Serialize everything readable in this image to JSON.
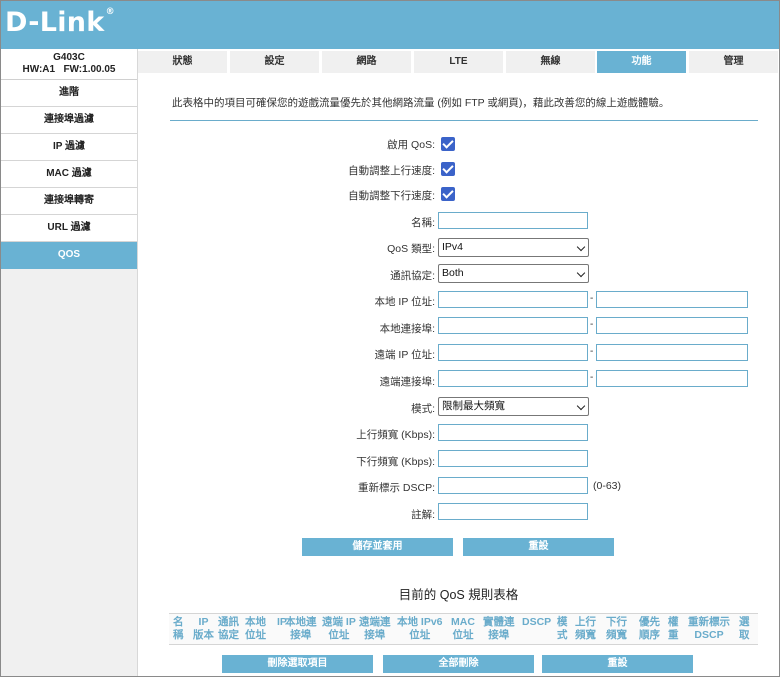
{
  "brand": {
    "logo": "D-Link",
    "reg_mark": "®"
  },
  "device": {
    "model": "G403C",
    "hw_label": "HW:A1",
    "fw_label": "FW:1.00.05"
  },
  "sidebar": {
    "items": [
      {
        "label": "進階",
        "active": false
      },
      {
        "label": "連接埠過濾",
        "active": false
      },
      {
        "label": "IP 過濾",
        "active": false
      },
      {
        "label": "MAC 過濾",
        "active": false
      },
      {
        "label": "連接埠轉寄",
        "active": false
      },
      {
        "label": "URL 過濾",
        "active": false
      },
      {
        "label": "QOS",
        "active": true
      }
    ]
  },
  "tabs": [
    {
      "label": "狀態",
      "active": false
    },
    {
      "label": "設定",
      "active": false
    },
    {
      "label": "網路",
      "active": false
    },
    {
      "label": "LTE",
      "active": false
    },
    {
      "label": "無線",
      "active": false
    },
    {
      "label": "功能",
      "active": true
    },
    {
      "label": "管理",
      "active": false
    }
  ],
  "intro": "此表格中的項目可確保您的遊戲流量優先於其他網路流量 (例如 FTP 或網頁)，藉此改善您的線上遊戲體驗。",
  "form": {
    "enable_qos_label": "啟用 QoS:",
    "enable_qos_checked": true,
    "auto_upload_label": "自動調整上行速度:",
    "auto_upload_checked": true,
    "auto_download_label": "自動調整下行速度:",
    "auto_download_checked": true,
    "name_label": "名稱:",
    "name_value": "",
    "qos_type_label": "QoS 類型:",
    "qos_type_value": "IPv4",
    "protocol_label": "通訊協定:",
    "protocol_value": "Both",
    "local_ip_label": "本地 IP 位址:",
    "local_port_label": "本地連接埠:",
    "remote_ip_label": "遠端 IP 位址:",
    "remote_port_label": "遠端連接埠:",
    "range_dash": "-",
    "mode_label": "模式:",
    "mode_value": "限制最大頻寬",
    "up_bw_label": "上行頻寬 (Kbps):",
    "down_bw_label": "下行頻寬 (Kbps):",
    "dscp_label": "重新標示 DSCP:",
    "dscp_hint": "(0-63)",
    "comment_label": "註解:",
    "save_button": "儲存並套用",
    "reset_button": "重設"
  },
  "rules_table": {
    "title": "目前的 QoS 規則表格",
    "columns": [
      [
        "名",
        "稱"
      ],
      [
        "IP",
        "版本"
      ],
      [
        "通訊",
        "協定"
      ],
      [
        "本地",
        "位址"
      ],
      [
        "IP",
        ""
      ],
      [
        "本地連",
        "接埠"
      ],
      [
        "遠端 IP",
        "位址"
      ],
      [
        "遠端連",
        "接埠"
      ],
      [
        "本地 IPv6",
        "位址"
      ],
      [
        "MAC",
        "位址"
      ],
      [
        "實體連",
        "接埠"
      ],
      [
        "DSCP",
        ""
      ],
      [
        "模",
        "式"
      ],
      [
        "上行",
        "頻寬"
      ],
      [
        "下行",
        "頻寬"
      ],
      [
        "優先",
        "順序"
      ],
      [
        "權",
        "重"
      ],
      [
        "重新標示",
        "DSCP"
      ],
      [
        "選",
        "取"
      ]
    ],
    "delete_selected_button": "刪除選取項目",
    "delete_all_button": "全部刪除",
    "reset_button": "重設"
  }
}
